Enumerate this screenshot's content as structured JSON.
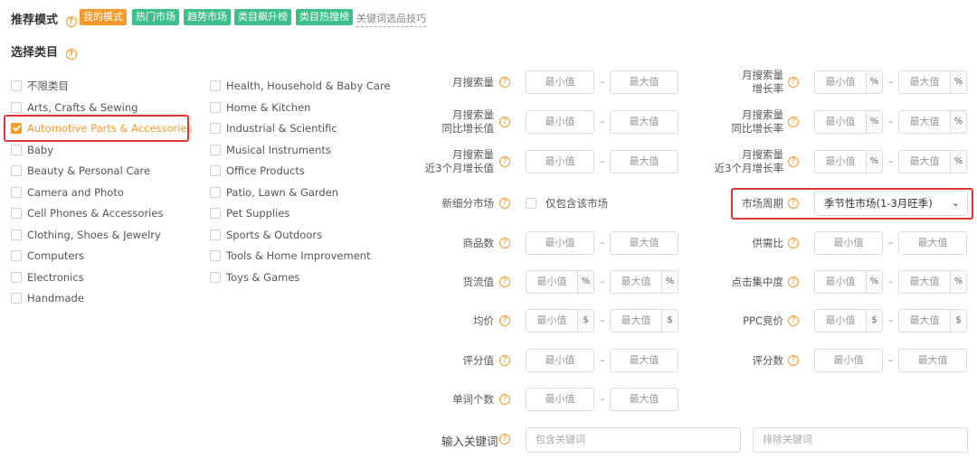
{
  "mode": {
    "label": "推荐模式",
    "tags": [
      "我的模式",
      "热门市场",
      "趋势市场",
      "类目飙升榜",
      "类目热搜榜"
    ],
    "tip_link": "关键词选品技巧"
  },
  "category": {
    "title": "选择类目",
    "col1": [
      "不限类目",
      "Arts, Crafts & Sewing",
      "Automotive Parts & Accessories",
      "Baby",
      "Beauty & Personal Care",
      "Camera and Photo",
      "Cell Phones & Accessories",
      "Clothing, Shoes & Jewelry",
      "Computers",
      "Electronics",
      "Handmade"
    ],
    "col2": [
      "Health, Household & Baby Care",
      "Home & Kitchen",
      "Industrial & Scientific",
      "Musical Instruments",
      "Office Products",
      "Patio, Lawn & Garden",
      "Pet Supplies",
      "Sports & Outdoors",
      "Tools & Home Improvement",
      "Toys & Games"
    ],
    "checked_col1_index": 2
  },
  "common": {
    "min": "最小值",
    "max": "最大值",
    "dash": "–",
    "pct": "%",
    "usd": "$"
  },
  "filters": {
    "left": {
      "monthly_search": "月搜索量",
      "monthly_search_yoy": [
        "月搜索量",
        "同比增长值"
      ],
      "monthly_search_3m": [
        "月搜索量",
        "近3个月增长值"
      ],
      "niche_market": "新细分市场",
      "niche_only": "仅包含该市场",
      "product_count": "商品数",
      "cargo_value": "货流值",
      "avg_price": "均价",
      "rating": "评分值",
      "word_count": "单词个数"
    },
    "right": {
      "search_growth": [
        "月搜索量",
        "增长率"
      ],
      "search_yoy_rate": [
        "月搜索量",
        "同比增长率"
      ],
      "search_3m_rate": [
        "月搜索量",
        "近3个月增长率"
      ],
      "market_cycle": "市场周期",
      "market_cycle_value": "季节性市场(1-3月旺季)",
      "supply_demand": "供需比",
      "click_concentration": "点击集中度",
      "ppc_bid": "PPC竞价",
      "rating_count": "评分数"
    }
  },
  "keyword": {
    "label": "输入关键词",
    "include_placeholder": "包含关键词",
    "exclude_placeholder": "排除关键词"
  },
  "colors": {
    "accent": "#f39a2a",
    "green": "#3cbf8a",
    "highlight": "#e03535"
  }
}
